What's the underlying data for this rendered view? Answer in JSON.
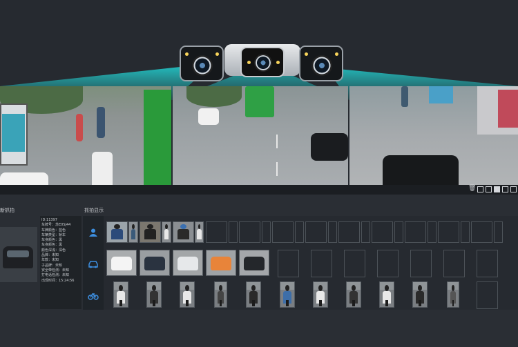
{
  "toolbar": {
    "icons": [
      "trash-icon",
      "fullscreen-icon",
      "layout-icon",
      "folder-icon",
      "grid-icon",
      "export-icon"
    ]
  },
  "panels": {
    "latest_label": "新抓拍",
    "capture_label": "抓拍显示"
  },
  "detail": {
    "lines": [
      "ID:11397",
      "车牌号：苏E0SJ44",
      "车牌颜色：蓝色",
      "车辆类型：轿车",
      "车身颜色：黑",
      "车身颜色：黑",
      "颜色深浅：深色",
      "品牌：未知",
      "年款：未知",
      "子品牌：未知",
      "安全带检测：未知",
      "打电话检测：未知",
      "出现时间：15:24:56"
    ]
  },
  "categories": [
    {
      "name": "person",
      "icon": "person-icon"
    },
    {
      "name": "vehicle",
      "icon": "car-icon"
    },
    {
      "name": "non-motor",
      "icon": "bicycle-icon"
    }
  ],
  "colors": {
    "accent": "#3d8fe0",
    "beam": "#1fd6d6",
    "background": "#262a30"
  }
}
